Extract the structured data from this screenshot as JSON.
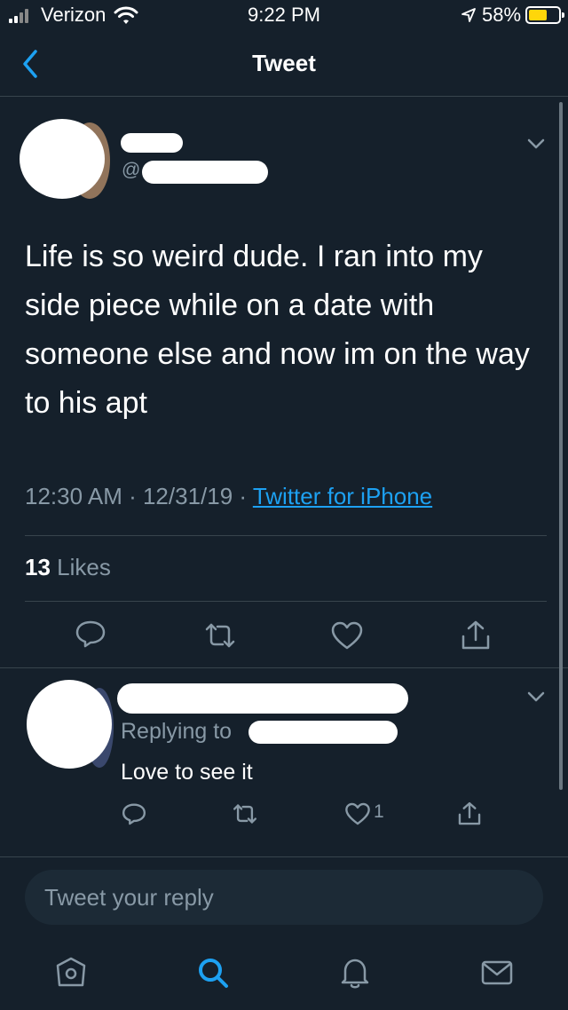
{
  "status_bar": {
    "carrier": "Verizon",
    "time": "9:22 PM",
    "battery_percent": "58%",
    "battery_level": 0.58,
    "battery_color": "#ffd60a"
  },
  "nav": {
    "title": "Tweet",
    "back_icon": "chevron-left-icon"
  },
  "tweet": {
    "handle_prefix": "@",
    "text": "Life is so weird dude. I ran into my side piece while on a date with someone else and now im on the way to his apt",
    "time": "12:30 AM",
    "date": "12/31/19",
    "separator": " · ",
    "source": "Twitter for iPhone",
    "likes_count": "13",
    "likes_label": " Likes",
    "actions": [
      "reply-icon",
      "retweet-icon",
      "like-icon",
      "share-icon"
    ]
  },
  "reply": {
    "replying_to_label": "Replying to",
    "text": "Love to see it",
    "like_count": "1",
    "actions": [
      "reply-icon",
      "retweet-icon",
      "like-icon",
      "share-icon"
    ]
  },
  "compose": {
    "placeholder": "Tweet your reply"
  },
  "tab_bar": {
    "items": [
      "home-icon",
      "search-icon",
      "notifications-icon",
      "messages-icon"
    ],
    "active": "search-icon"
  },
  "colors": {
    "background": "#15202b",
    "accent": "#1da1f2",
    "secondary_text": "#8899a6",
    "divider": "#38444d"
  }
}
